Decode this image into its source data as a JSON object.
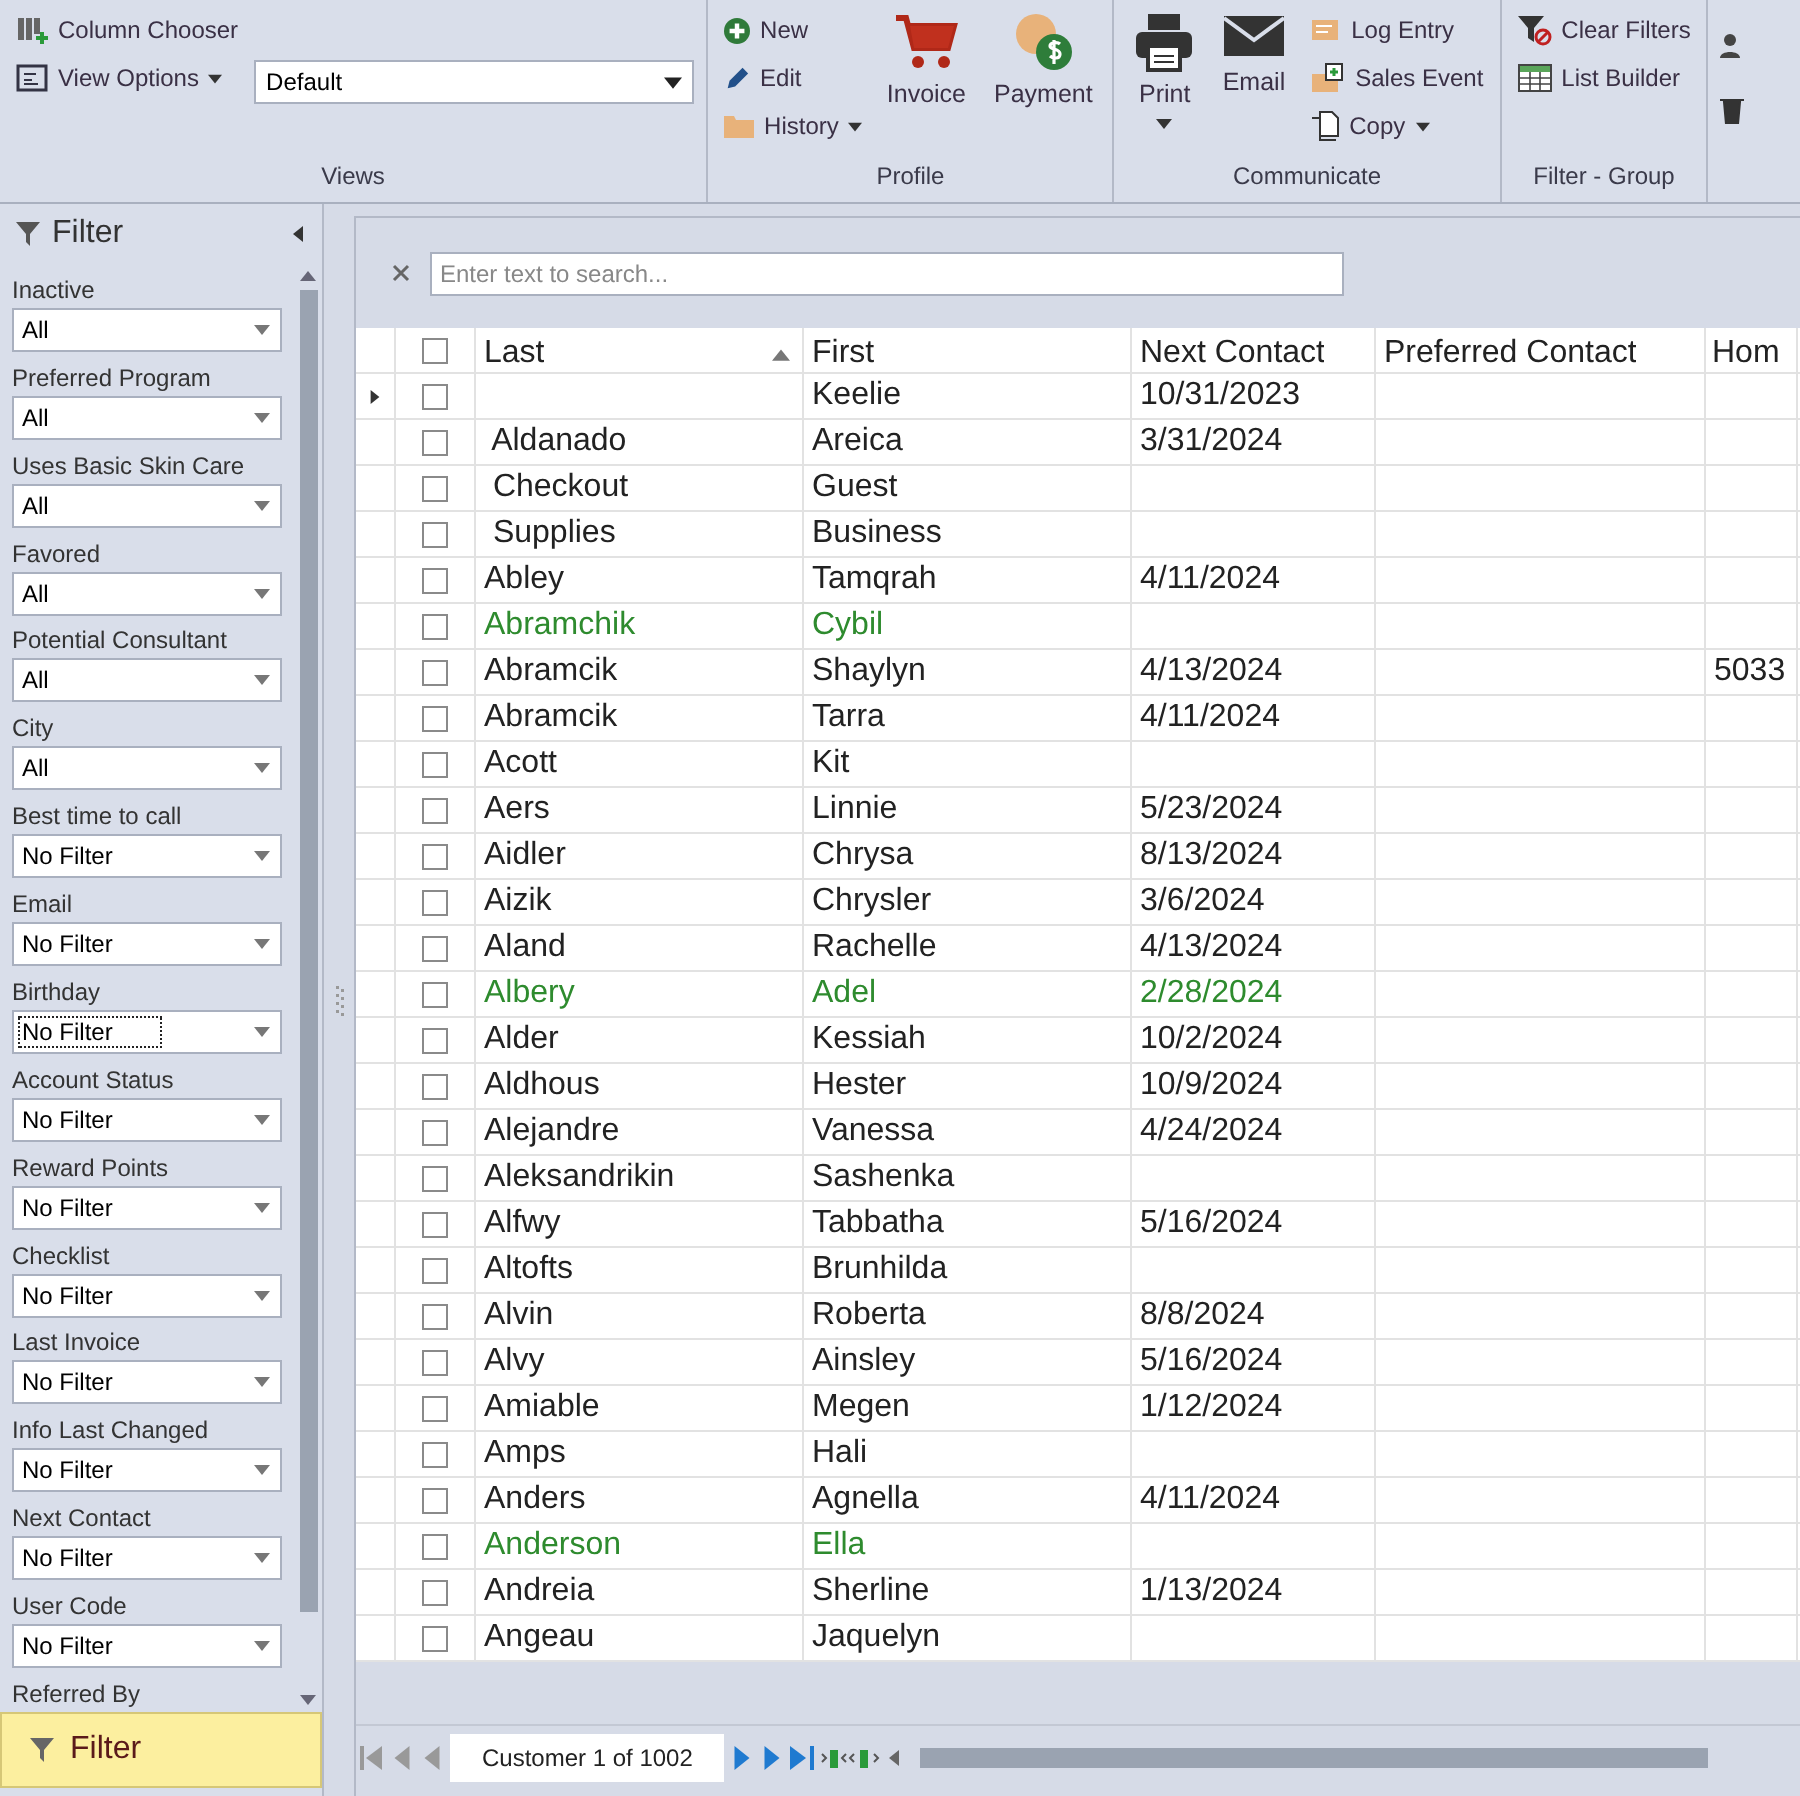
{
  "ribbon": {
    "groups": [
      {
        "label": "Views",
        "items": [
          {
            "kind": "small",
            "label": "Column Chooser",
            "dropdown": false
          },
          {
            "kind": "small",
            "label": "View Options",
            "dropdown": true
          },
          {
            "kind": "combo",
            "value": "Default"
          }
        ]
      },
      {
        "label": "Profile",
        "items": [
          {
            "kind": "small",
            "label": "New",
            "dropdown": false
          },
          {
            "kind": "small",
            "label": "Edit",
            "dropdown": false
          },
          {
            "kind": "small",
            "label": "History",
            "dropdown": true
          },
          {
            "kind": "large",
            "label": "Invoice",
            "dropdown": false
          },
          {
            "kind": "large",
            "label": "Payment",
            "dropdown": false
          }
        ]
      },
      {
        "label": "Communicate",
        "items": [
          {
            "kind": "large",
            "label": "Print",
            "dropdown": true
          },
          {
            "kind": "large",
            "label": "Email",
            "dropdown": false
          },
          {
            "kind": "small",
            "label": "Log Entry",
            "dropdown": false
          },
          {
            "kind": "small",
            "label": "Sales Event",
            "dropdown": false
          },
          {
            "kind": "small",
            "label": "Copy",
            "dropdown": true
          }
        ]
      },
      {
        "label": "Filter - Group",
        "items": [
          {
            "kind": "small",
            "label": "Clear Filters",
            "dropdown": false
          },
          {
            "kind": "small",
            "label": "List Builder",
            "dropdown": false
          }
        ]
      }
    ]
  },
  "filter_panel": {
    "title": "Filter",
    "filters": [
      {
        "label": "Inactive",
        "value": "All",
        "focused": false
      },
      {
        "label": "Preferred Program",
        "value": "All",
        "focused": false
      },
      {
        "label": "Uses Basic Skin Care",
        "value": "All",
        "focused": false
      },
      {
        "label": "Favored",
        "value": "All",
        "focused": false
      },
      {
        "label": "Potential Consultant",
        "value": "All",
        "focused": false
      },
      {
        "label": "City",
        "value": "All",
        "focused": false
      },
      {
        "label": "Best time to call",
        "value": "No Filter",
        "focused": false
      },
      {
        "label": "Email",
        "value": "No Filter",
        "focused": false
      },
      {
        "label": "Birthday",
        "value": "No Filter",
        "focused": true
      },
      {
        "label": "Account Status",
        "value": "No Filter",
        "focused": false
      },
      {
        "label": "Reward Points",
        "value": "No Filter",
        "focused": false
      },
      {
        "label": "Checklist",
        "value": "No Filter",
        "focused": false
      },
      {
        "label": "Last Invoice",
        "value": "No Filter",
        "focused": false
      },
      {
        "label": "Info Last Changed",
        "value": "No Filter",
        "focused": false
      },
      {
        "label": "Next Contact",
        "value": "No Filter",
        "focused": false
      },
      {
        "label": "User Code",
        "value": "No Filter",
        "focused": false
      },
      {
        "label": "Referred By"
      }
    ],
    "tab": "Filter"
  },
  "grid": {
    "search": {
      "placeholder": "Enter text to search..."
    },
    "select_all_checked": false,
    "columns": [
      {
        "label": "Last",
        "sorted": true
      },
      {
        "label": "First",
        "sorted": false
      },
      {
        "label": "Next Contact",
        "sorted": false
      },
      {
        "label": "Preferred Contact",
        "sorted": false
      },
      {
        "label": "Hom",
        "sorted": false
      }
    ],
    "rows": [
      {
        "cells": [
          "",
          "Keelie",
          "10/31/2023",
          "",
          ""
        ],
        "current": true,
        "highlighted": false,
        "checked": false
      },
      {
        "cells": [
          " Aldanado",
          "Areica",
          "3/31/2024",
          "",
          ""
        ],
        "current": false,
        "highlighted": false,
        "checked": false
      },
      {
        "cells": [
          " Checkout",
          "Guest",
          "",
          "",
          ""
        ],
        "current": false,
        "highlighted": false,
        "checked": false
      },
      {
        "cells": [
          " Supplies",
          "Business",
          "",
          "",
          ""
        ],
        "current": false,
        "highlighted": false,
        "checked": false
      },
      {
        "cells": [
          "Abley",
          "Tamqrah",
          "4/11/2024",
          "",
          ""
        ],
        "current": false,
        "highlighted": false,
        "checked": false
      },
      {
        "cells": [
          "Abramchik",
          "Cybil",
          "",
          "",
          ""
        ],
        "current": false,
        "highlighted": true,
        "checked": false
      },
      {
        "cells": [
          "Abramcik",
          "Shaylyn",
          "4/13/2024",
          "",
          "5033"
        ],
        "current": false,
        "highlighted": false,
        "checked": false
      },
      {
        "cells": [
          "Abramcik",
          "Tarra",
          "4/11/2024",
          "",
          ""
        ],
        "current": false,
        "highlighted": false,
        "checked": false
      },
      {
        "cells": [
          "Acott",
          "Kit",
          "",
          "",
          ""
        ],
        "current": false,
        "highlighted": false,
        "checked": false
      },
      {
        "cells": [
          "Aers",
          "Linnie",
          "5/23/2024",
          "",
          ""
        ],
        "current": false,
        "highlighted": false,
        "checked": false
      },
      {
        "cells": [
          "Aidler",
          "Chrysa",
          "8/13/2024",
          "",
          ""
        ],
        "current": false,
        "highlighted": false,
        "checked": false
      },
      {
        "cells": [
          "Aizik",
          "Chrysler",
          "3/6/2024",
          "",
          ""
        ],
        "current": false,
        "highlighted": false,
        "checked": false
      },
      {
        "cells": [
          "Aland",
          "Rachelle",
          "4/13/2024",
          "",
          ""
        ],
        "current": false,
        "highlighted": false,
        "checked": false
      },
      {
        "cells": [
          "Albery",
          "Adel",
          "2/28/2024",
          "",
          ""
        ],
        "current": false,
        "highlighted": true,
        "checked": false
      },
      {
        "cells": [
          "Alder",
          "Kessiah",
          "10/2/2024",
          "",
          ""
        ],
        "current": false,
        "highlighted": false,
        "checked": false
      },
      {
        "cells": [
          "Aldhous",
          "Hester",
          "10/9/2024",
          "",
          ""
        ],
        "current": false,
        "highlighted": false,
        "checked": false
      },
      {
        "cells": [
          "Alejandre",
          "Vanessa",
          "4/24/2024",
          "",
          ""
        ],
        "current": false,
        "highlighted": false,
        "checked": false
      },
      {
        "cells": [
          "Aleksandrikin",
          "Sashenka",
          "",
          "",
          ""
        ],
        "current": false,
        "highlighted": false,
        "checked": false
      },
      {
        "cells": [
          "Alfwy",
          "Tabbatha",
          "5/16/2024",
          "",
          ""
        ],
        "current": false,
        "highlighted": false,
        "checked": false
      },
      {
        "cells": [
          "Altofts",
          "Brunhilda",
          "",
          "",
          ""
        ],
        "current": false,
        "highlighted": false,
        "checked": false
      },
      {
        "cells": [
          "Alvin",
          "Roberta",
          "8/8/2024",
          "",
          ""
        ],
        "current": false,
        "highlighted": false,
        "checked": false
      },
      {
        "cells": [
          "Alvy",
          "Ainsley",
          "5/16/2024",
          "",
          ""
        ],
        "current": false,
        "highlighted": false,
        "checked": false
      },
      {
        "cells": [
          "Amiable",
          "Megen",
          "1/12/2024",
          "",
          ""
        ],
        "current": false,
        "highlighted": false,
        "checked": false
      },
      {
        "cells": [
          "Amps",
          "Hali",
          "",
          "",
          ""
        ],
        "current": false,
        "highlighted": false,
        "checked": false
      },
      {
        "cells": [
          "Anders",
          "Agnella",
          "4/11/2024",
          "",
          ""
        ],
        "current": false,
        "highlighted": false,
        "checked": false
      },
      {
        "cells": [
          "Anderson",
          "Ella",
          "",
          "",
          ""
        ],
        "current": false,
        "highlighted": true,
        "checked": false
      },
      {
        "cells": [
          "Andreia",
          "Sherline",
          "1/13/2024",
          "",
          ""
        ],
        "current": false,
        "highlighted": false,
        "checked": false
      },
      {
        "cells": [
          "Angeau",
          "Jaquelyn",
          "",
          "",
          ""
        ],
        "current": false,
        "highlighted": false,
        "checked": false
      }
    ],
    "navigator": {
      "text": "Customer 1 of 1002"
    }
  }
}
